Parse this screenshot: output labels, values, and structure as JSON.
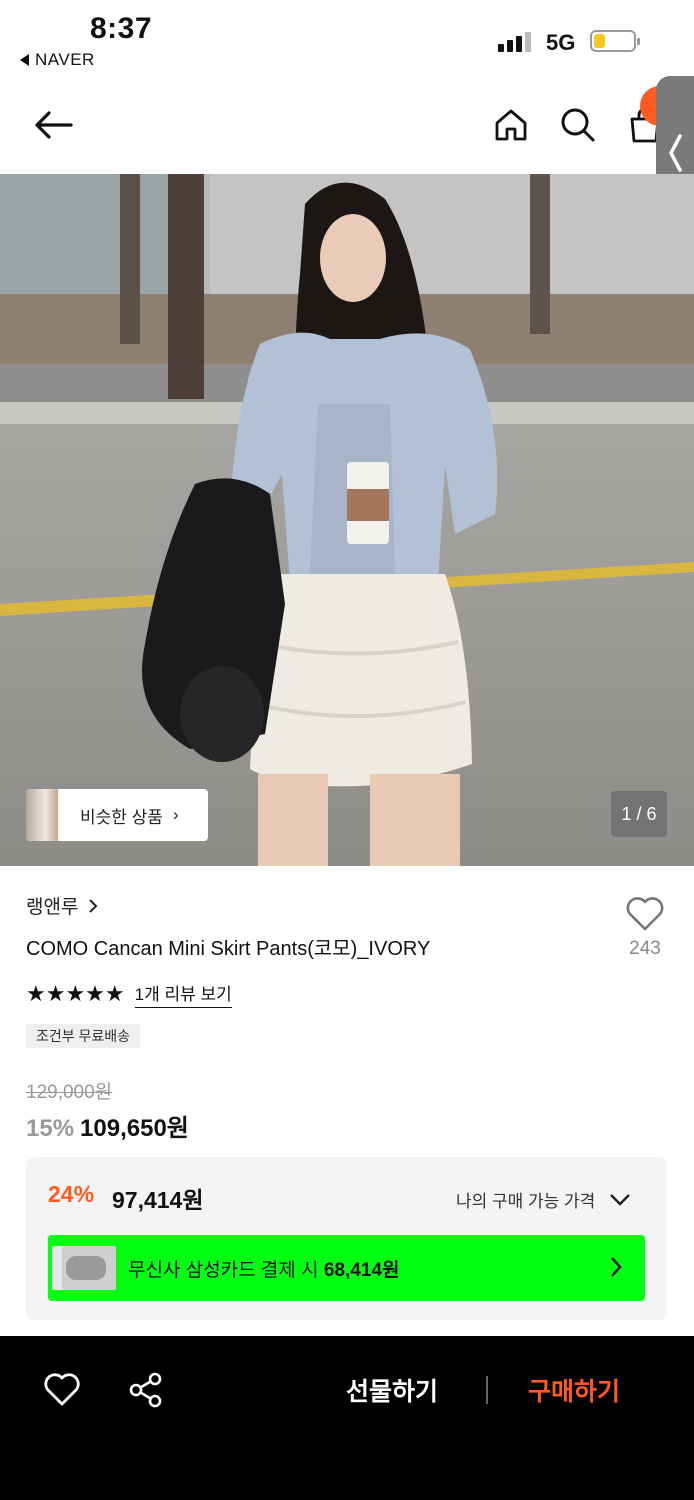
{
  "status_bar": {
    "time": "8:37",
    "back_app": "NAVER",
    "network": "5G",
    "battery_level": 0.3
  },
  "product": {
    "brand": "랭앤루",
    "title": "COMO Cancan Mini Skirt Pants(코모)_IVORY",
    "like_count": "243",
    "stars": "★★★★★",
    "review_link": "1개 리뷰 보기",
    "shipping_badge": "조건부 무료배송",
    "original_price": "129,000원",
    "discount_rate": "15%",
    "price": "109,650원"
  },
  "gallery": {
    "similar_label": "비슷한 상품",
    "page_indicator": "1 / 6"
  },
  "member_price": {
    "discount_rate": "24%",
    "price": "97,414원",
    "label": "나의 구매 가능 가격",
    "card_promo_prefix": "무신사 삼성카드 결제 시 ",
    "card_promo_amount": "68,414원",
    "promo_color": "#00ff10"
  },
  "bottom_bar": {
    "gift_label": "선물하기",
    "buy_label": "구매하기",
    "accent_color": "#ff5a1f"
  }
}
